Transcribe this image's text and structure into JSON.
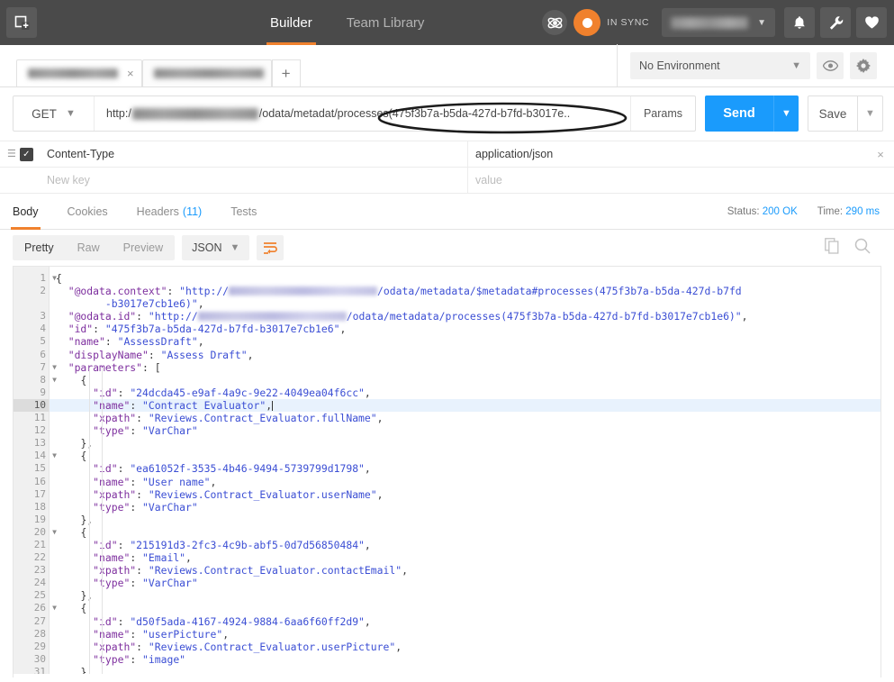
{
  "app_header": {
    "new_tab_icon": "new-window-icon",
    "tabs": [
      {
        "label": "Builder",
        "active": true
      },
      {
        "label": "Team Library",
        "active": false
      }
    ],
    "sync_label": "IN SYNC",
    "sync_icon_a": "atom-icon",
    "sync_icon_b": "sync-status-icon",
    "user_name_redacted": true,
    "icons": [
      {
        "name": "bell-icon",
        "glyph": "🔔"
      },
      {
        "name": "wrench-icon",
        "glyph": "🔧"
      },
      {
        "name": "heart-icon",
        "glyph": "♥"
      }
    ],
    "accent_color": "#f0812d",
    "background_color": "#4a4a4a"
  },
  "tabstrip": {
    "request_tabs": [
      {
        "redacted": true,
        "active": true,
        "close_label": "×"
      },
      {
        "redacted": true,
        "active": false,
        "close_label": ""
      }
    ],
    "add_tab_label": "+",
    "environment": {
      "selected": "No Environment",
      "chevron": "∨"
    },
    "eye_icon": "eye-icon",
    "gear_icon": "gear-icon"
  },
  "urlbar": {
    "method": "GET",
    "method_chevron": "∨",
    "url_prefix": "http:/",
    "url_host_redacted": true,
    "url_path_a": "/odata/metadat",
    "url_path_b": "/processes(475f3b7a-b5da-427d-b7fd-b3017e..",
    "params_label": "Params",
    "send_label": "Send",
    "send_chevron": "∨",
    "save_label": "Save",
    "save_chevron": "∨",
    "send_color": "#1a9bfc",
    "annotation": "ellipse-highlight"
  },
  "headers_table": {
    "rows": [
      {
        "checked": true,
        "key": "Content-Type",
        "value": "application/json",
        "remove": "×"
      }
    ],
    "new_row": {
      "key_placeholder": "New key",
      "value_placeholder": "value"
    }
  },
  "response": {
    "tabs": [
      {
        "label": "Body",
        "count": "",
        "active": true
      },
      {
        "label": "Cookies",
        "count": "",
        "active": false
      },
      {
        "label": "Headers",
        "count": "(11)",
        "active": false
      },
      {
        "label": "Tests",
        "count": "",
        "active": false
      }
    ],
    "status_label": "Status:",
    "status_value": "200 OK",
    "time_label": "Time:",
    "time_value": "290 ms",
    "meta_color": "#1a9bfc"
  },
  "body_toolbar": {
    "view_modes": [
      {
        "label": "Pretty",
        "active": true
      },
      {
        "label": "Raw",
        "active": false
      },
      {
        "label": "Preview",
        "active": false
      }
    ],
    "format": "JSON",
    "format_chevron": "∨",
    "wrap_icon": "word-wrap-icon",
    "copy_icon": "copy-icon",
    "search_icon": "search-icon"
  },
  "code": {
    "highlighted_line": 10,
    "lines": [
      {
        "n": 1,
        "fold": true,
        "indent": 0,
        "html": "<span class=\"tok-punc\">{</span>"
      },
      {
        "n": 2,
        "fold": false,
        "indent": 1,
        "html": "<span class=\"tok-key\">\"@odata.context\"</span><span class=\"tok-punc\">: </span><span class=\"tok-str\">\"http://</span><span class=\"inline-redact\"></span><span class=\"tok-str\">/odata/metadata/$metadata#processes(475f3b7a-b5da-427d-b7fd</span>"
      },
      {
        "n": null,
        "fold": false,
        "indent": 0,
        "html": "        <span class=\"tok-str\">-b3017e7cb1e6)\"</span><span class=\"tok-punc\">,</span>"
      },
      {
        "n": 3,
        "fold": false,
        "indent": 1,
        "html": "<span class=\"tok-key\">\"@odata.id\"</span><span class=\"tok-punc\">: </span><span class=\"tok-str\">\"http://</span><span class=\"inline-redact\"></span><span class=\"tok-str\">/odata/metadata/processes(475f3b7a-b5da-427d-b7fd-b3017e7cb1e6)\"</span><span class=\"tok-punc\">,</span>"
      },
      {
        "n": 4,
        "fold": false,
        "indent": 1,
        "html": "<span class=\"tok-key\">\"id\"</span><span class=\"tok-punc\">: </span><span class=\"tok-str\">\"475f3b7a-b5da-427d-b7fd-b3017e7cb1e6\"</span><span class=\"tok-punc\">,</span>"
      },
      {
        "n": 5,
        "fold": false,
        "indent": 1,
        "html": "<span class=\"tok-key\">\"name\"</span><span class=\"tok-punc\">: </span><span class=\"tok-str\">\"AssessDraft\"</span><span class=\"tok-punc\">,</span>"
      },
      {
        "n": 6,
        "fold": false,
        "indent": 1,
        "html": "<span class=\"tok-key\">\"displayName\"</span><span class=\"tok-punc\">: </span><span class=\"tok-str\">\"Assess Draft\"</span><span class=\"tok-punc\">,</span>"
      },
      {
        "n": 7,
        "fold": true,
        "indent": 1,
        "html": "<span class=\"tok-key\">\"parameters\"</span><span class=\"tok-punc\">: [</span>"
      },
      {
        "n": 8,
        "fold": true,
        "indent": 2,
        "html": "<span class=\"tok-punc\">{</span>"
      },
      {
        "n": 9,
        "fold": false,
        "indent": 3,
        "html": "<span class=\"tok-key\">\"id\"</span><span class=\"tok-punc\">: </span><span class=\"tok-str\">\"24dcda45-e9af-4a9c-9e22-4049ea04f6cc\"</span><span class=\"tok-punc\">,</span>"
      },
      {
        "n": 10,
        "fold": false,
        "indent": 3,
        "hl": true,
        "html": "<span class=\"tok-key\">\"name\"</span><span class=\"tok-punc\">: </span><span class=\"tok-str\">\"Contract Evaluator\"</span><span class=\"tok-punc\">,</span><span class=\"caret-bar\"></span>"
      },
      {
        "n": 11,
        "fold": false,
        "indent": 3,
        "html": "<span class=\"tok-key\">\"xpath\"</span><span class=\"tok-punc\">: </span><span class=\"tok-str\">\"Reviews.Contract_Evaluator.fullName\"</span><span class=\"tok-punc\">,</span>"
      },
      {
        "n": 12,
        "fold": false,
        "indent": 3,
        "html": "<span class=\"tok-key\">\"type\"</span><span class=\"tok-punc\">: </span><span class=\"tok-str\">\"VarChar\"</span>"
      },
      {
        "n": 13,
        "fold": false,
        "indent": 2,
        "html": "<span class=\"tok-punc\">},</span>"
      },
      {
        "n": 14,
        "fold": true,
        "indent": 2,
        "html": "<span class=\"tok-punc\">{</span>"
      },
      {
        "n": 15,
        "fold": false,
        "indent": 3,
        "html": "<span class=\"tok-key\">\"id\"</span><span class=\"tok-punc\">: </span><span class=\"tok-str\">\"ea61052f-3535-4b46-9494-5739799d1798\"</span><span class=\"tok-punc\">,</span>"
      },
      {
        "n": 16,
        "fold": false,
        "indent": 3,
        "html": "<span class=\"tok-key\">\"name\"</span><span class=\"tok-punc\">: </span><span class=\"tok-str\">\"User name\"</span><span class=\"tok-punc\">,</span>"
      },
      {
        "n": 17,
        "fold": false,
        "indent": 3,
        "html": "<span class=\"tok-key\">\"xpath\"</span><span class=\"tok-punc\">: </span><span class=\"tok-str\">\"Reviews.Contract_Evaluator.userName\"</span><span class=\"tok-punc\">,</span>"
      },
      {
        "n": 18,
        "fold": false,
        "indent": 3,
        "html": "<span class=\"tok-key\">\"type\"</span><span class=\"tok-punc\">: </span><span class=\"tok-str\">\"VarChar\"</span>"
      },
      {
        "n": 19,
        "fold": false,
        "indent": 2,
        "html": "<span class=\"tok-punc\">},</span>"
      },
      {
        "n": 20,
        "fold": true,
        "indent": 2,
        "html": "<span class=\"tok-punc\">{</span>"
      },
      {
        "n": 21,
        "fold": false,
        "indent": 3,
        "html": "<span class=\"tok-key\">\"id\"</span><span class=\"tok-punc\">: </span><span class=\"tok-str\">\"215191d3-2fc3-4c9b-abf5-0d7d56850484\"</span><span class=\"tok-punc\">,</span>"
      },
      {
        "n": 22,
        "fold": false,
        "indent": 3,
        "html": "<span class=\"tok-key\">\"name\"</span><span class=\"tok-punc\">: </span><span class=\"tok-str\">\"Email\"</span><span class=\"tok-punc\">,</span>"
      },
      {
        "n": 23,
        "fold": false,
        "indent": 3,
        "html": "<span class=\"tok-key\">\"xpath\"</span><span class=\"tok-punc\">: </span><span class=\"tok-str\">\"Reviews.Contract_Evaluator.contactEmail\"</span><span class=\"tok-punc\">,</span>"
      },
      {
        "n": 24,
        "fold": false,
        "indent": 3,
        "html": "<span class=\"tok-key\">\"type\"</span><span class=\"tok-punc\">: </span><span class=\"tok-str\">\"VarChar\"</span>"
      },
      {
        "n": 25,
        "fold": false,
        "indent": 2,
        "html": "<span class=\"tok-punc\">},</span>"
      },
      {
        "n": 26,
        "fold": true,
        "indent": 2,
        "html": "<span class=\"tok-punc\">{</span>"
      },
      {
        "n": 27,
        "fold": false,
        "indent": 3,
        "html": "<span class=\"tok-key\">\"id\"</span><span class=\"tok-punc\">: </span><span class=\"tok-str\">\"d50f5ada-4167-4924-9884-6aa6f60ff2d9\"</span><span class=\"tok-punc\">,</span>"
      },
      {
        "n": 28,
        "fold": false,
        "indent": 3,
        "html": "<span class=\"tok-key\">\"name\"</span><span class=\"tok-punc\">: </span><span class=\"tok-str\">\"userPicture\"</span><span class=\"tok-punc\">,</span>"
      },
      {
        "n": 29,
        "fold": false,
        "indent": 3,
        "html": "<span class=\"tok-key\">\"xpath\"</span><span class=\"tok-punc\">: </span><span class=\"tok-str\">\"Reviews.Contract_Evaluator.userPicture\"</span><span class=\"tok-punc\">,</span>"
      },
      {
        "n": 30,
        "fold": false,
        "indent": 3,
        "html": "<span class=\"tok-key\">\"type\"</span><span class=\"tok-punc\">: </span><span class=\"tok-str\">\"image\"</span>"
      },
      {
        "n": 31,
        "fold": false,
        "indent": 2,
        "html": "<span class=\"tok-punc\">}</span>"
      }
    ]
  }
}
